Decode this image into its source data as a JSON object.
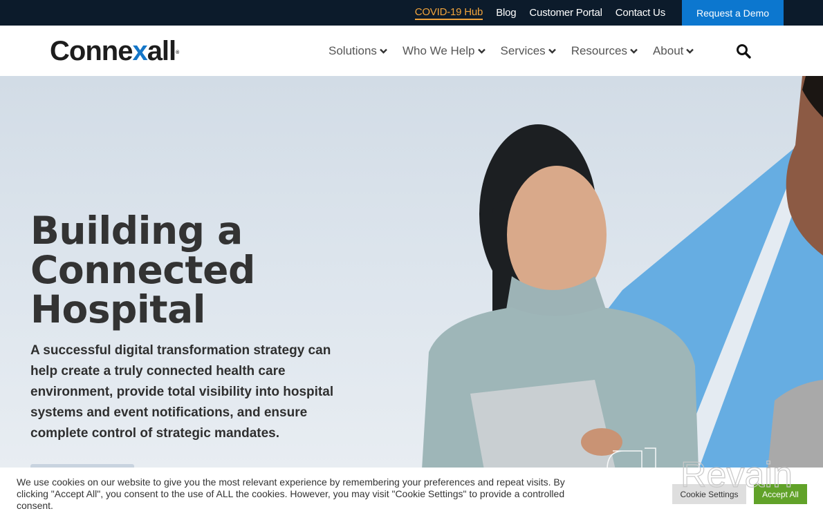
{
  "topbar": {
    "links": [
      {
        "label": "COVID-19 Hub",
        "highlight": true
      },
      {
        "label": "Blog"
      },
      {
        "label": "Customer Portal"
      },
      {
        "label": "Contact Us"
      }
    ],
    "demo_button": "Request a Demo"
  },
  "header": {
    "logo": {
      "pre": "Conne",
      "accent": "x",
      "post": "all",
      "mark": "®"
    },
    "nav": [
      {
        "label": "Solutions"
      },
      {
        "label": "Who We Help"
      },
      {
        "label": "Services"
      },
      {
        "label": "Resources"
      },
      {
        "label": "About"
      }
    ],
    "search_icon": "search-icon"
  },
  "hero": {
    "title_lines": [
      "Building a",
      "Connected",
      "Hospital"
    ],
    "body": "A successful digital transformation strategy can help create a truly connected health care environment, provide total visibility into hospital systems and event notifications, and ensure complete control of strategic mandates."
  },
  "cookie_banner": {
    "message": "We use cookies on our website to give you the most relevant experience by remembering your preferences and repeat visits. By clicking \"Accept All\", you consent to the use of ALL the cookies. However, you may visit \"Cookie Settings\" to provide a controlled consent.",
    "settings_button": "Cookie Settings",
    "accept_button": "Accept All"
  },
  "watermark": {
    "text": "Revain"
  },
  "colors": {
    "topbar_bg": "#0c1b2b",
    "covid_link": "#f0a33c",
    "demo_button": "#0c77cf",
    "logo_accent": "#1476c8",
    "accept_green": "#61a229",
    "hero_shape_blue": "#66ade2"
  }
}
